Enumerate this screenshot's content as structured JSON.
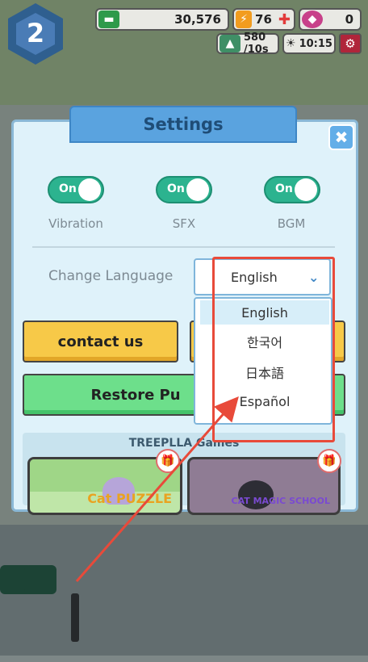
{
  "hud": {
    "level": "2",
    "cash": "30,576",
    "energy": "76",
    "gems": "0",
    "income": "580 /10s",
    "time": "10:15"
  },
  "settings": {
    "title": "Settings",
    "toggles": [
      {
        "state": "On",
        "label": "Vibration"
      },
      {
        "state": "On",
        "label": "SFX"
      },
      {
        "state": "On",
        "label": "BGM"
      }
    ],
    "language": {
      "label": "Change Language",
      "selected": "English",
      "options": [
        "English",
        "한국어",
        "日本語",
        "Español"
      ]
    },
    "contact_label": "contact us",
    "restore_label": "Restore Pu",
    "games_title": "TREEPLLA Games",
    "games": [
      {
        "name": "Cat PUZZLE"
      },
      {
        "name": "CAT MAGIC SCHOOL"
      }
    ]
  },
  "colors": {
    "toggle_on": "#2cb38f",
    "title_tab": "#5aa3df",
    "highlight": "#e84a3a",
    "contact_button": "#f7c948",
    "restore_button": "#6ddf8b"
  }
}
